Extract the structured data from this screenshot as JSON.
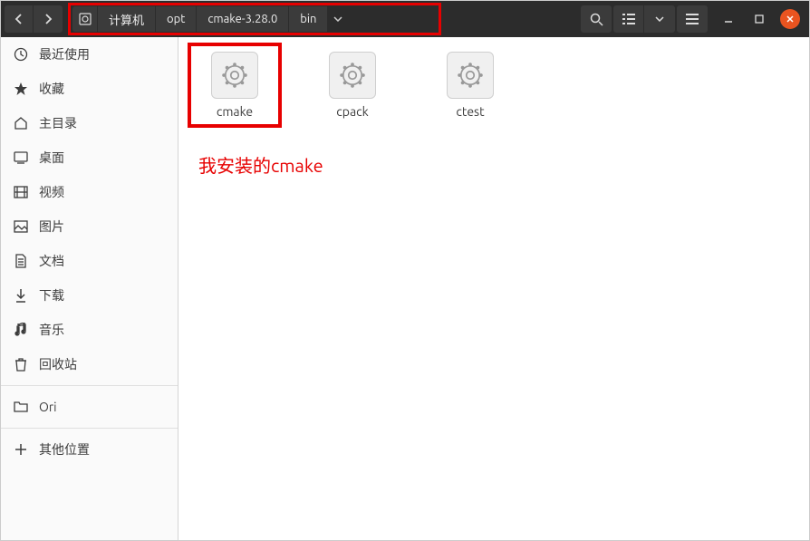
{
  "breadcrumb": {
    "segments": [
      "计算机",
      "opt",
      "cmake-3.28.0",
      "bin"
    ]
  },
  "sidebar": {
    "items": [
      {
        "icon": "clock",
        "label": "最近使用"
      },
      {
        "icon": "star",
        "label": "收藏"
      },
      {
        "icon": "home",
        "label": "主目录"
      },
      {
        "icon": "desktop",
        "label": "桌面"
      },
      {
        "icon": "video",
        "label": "视频"
      },
      {
        "icon": "image",
        "label": "图片"
      },
      {
        "icon": "doc",
        "label": "文档"
      },
      {
        "icon": "download",
        "label": "下载"
      },
      {
        "icon": "music",
        "label": "音乐"
      },
      {
        "icon": "trash",
        "label": "回收站"
      }
    ],
    "folder": {
      "icon": "folder",
      "label": "Ori"
    },
    "other": {
      "icon": "plus",
      "label": "其他位置"
    }
  },
  "files": [
    {
      "name": "cmake",
      "highlighted": true
    },
    {
      "name": "cpack",
      "highlighted": false
    },
    {
      "name": "ctest",
      "highlighted": false
    }
  ],
  "annotation": "我安装的cmake"
}
